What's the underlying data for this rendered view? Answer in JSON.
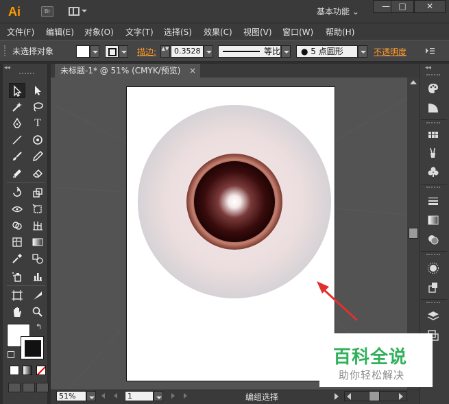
{
  "app": {
    "logo": "Ai",
    "bridge": "Br",
    "workspace": "基本功能 ⌄",
    "min": "—",
    "max": "□",
    "close": "✕"
  },
  "menu": [
    "文件(F)",
    "编辑(E)",
    "对象(O)",
    "文字(T)",
    "选择(S)",
    "效果(C)",
    "视图(V)",
    "窗口(W)",
    "帮助(H)"
  ],
  "control": {
    "selection": "未选择对象",
    "stroke_label": "描边:",
    "stroke_weight": "0.3528",
    "profile": "等比",
    "brush": "●  5 点圆形",
    "opacity_label": "不透明度",
    "spin": "▲▼"
  },
  "document": {
    "tab_label": "未标题-1* @ 51% (CMYK/预览)",
    "tab_close": "×"
  },
  "status": {
    "zoom": "51%",
    "page": "1",
    "text": "编组选择"
  },
  "tools": {
    "type": "T",
    "swap": "↰"
  },
  "colors": {
    "accent_orange": "#ff9a2a",
    "iris_dark": "#2a0808",
    "iris_rim": "#b86a5a",
    "sclera": "#ece0e0",
    "arrow": "#e03030",
    "watermark_green": "#2fb15a"
  },
  "watermark": {
    "title": "百科全说",
    "subtitle": "助你轻松解决"
  }
}
